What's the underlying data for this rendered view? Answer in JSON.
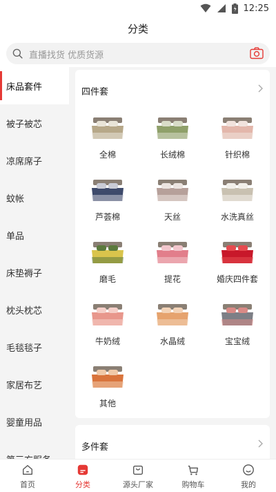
{
  "status": {
    "time": "12:25",
    "icons": [
      "wifi-icon",
      "signal-icon",
      "battery-icon"
    ]
  },
  "header": {
    "title": "分类"
  },
  "search": {
    "placeholder": "直播找货 优质货源",
    "icon": "search-icon",
    "camera_icon": "camera-icon"
  },
  "colors": {
    "accent": "#e53935",
    "background": "#f4f4f4"
  },
  "sidebar": {
    "items": [
      {
        "label": "床品套件",
        "active": true
      },
      {
        "label": "被子被芯"
      },
      {
        "label": "凉席席子"
      },
      {
        "label": "蚊帐"
      },
      {
        "label": "单品"
      },
      {
        "label": "床垫褥子"
      },
      {
        "label": "枕头枕芯"
      },
      {
        "label": "毛毯毯子"
      },
      {
        "label": "家居布艺"
      },
      {
        "label": "婴童用品"
      },
      {
        "label": "第三方服务"
      }
    ]
  },
  "sections": [
    {
      "title": "四件套",
      "items": [
        {
          "label": "全棉",
          "colors": [
            "#b7a889",
            "#e9e4d8"
          ]
        },
        {
          "label": "长绒棉",
          "colors": [
            "#8fa06a",
            "#d9dcc8"
          ]
        },
        {
          "label": "针织棉",
          "colors": [
            "#e3b7ab",
            "#f1e3dd"
          ]
        },
        {
          "label": "芦荟棉",
          "colors": [
            "#3e4a6b",
            "#c9cbd6"
          ]
        },
        {
          "label": "天丝",
          "colors": [
            "#b6a09a",
            "#ece4e0"
          ]
        },
        {
          "label": "水洗真丝",
          "colors": [
            "#c9c1b1",
            "#f2efe9"
          ]
        },
        {
          "label": "磨毛",
          "colors": [
            "#d9c44c",
            "#5b7a3d"
          ]
        },
        {
          "label": "提花",
          "colors": [
            "#e27e8b",
            "#f2c6cc"
          ]
        },
        {
          "label": "婚庆四件套",
          "colors": [
            "#c8182a",
            "#e64a4f"
          ]
        },
        {
          "label": "牛奶绒",
          "colors": [
            "#e8978c",
            "#f5cfc8"
          ]
        },
        {
          "label": "水晶绒",
          "colors": [
            "#e6a36e",
            "#f3d3b7"
          ]
        },
        {
          "label": "宝宝绒",
          "colors": [
            "#7d7f86",
            "#d98a86"
          ]
        },
        {
          "label": "其他",
          "colors": [
            "#d9743c",
            "#f0c9a8"
          ]
        }
      ]
    },
    {
      "title": "多件套"
    }
  ],
  "tabbar": {
    "items": [
      {
        "label": "首页",
        "icon": "home-icon"
      },
      {
        "label": "分类",
        "icon": "category-icon",
        "active": true
      },
      {
        "label": "源头厂家",
        "icon": "factory-icon"
      },
      {
        "label": "购物车",
        "icon": "cart-icon"
      },
      {
        "label": "我的",
        "icon": "profile-icon"
      }
    ]
  }
}
